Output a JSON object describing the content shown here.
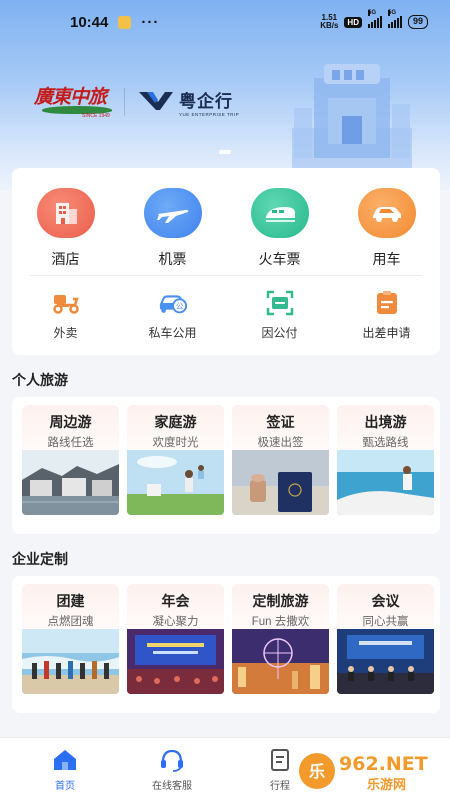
{
  "status_bar": {
    "time": "10:44",
    "dots": "···",
    "net_speed_value": "1.51",
    "net_speed_unit": "KB/s",
    "hd": "HD",
    "signal1": "5G",
    "signal2": "5G",
    "battery": "99"
  },
  "brand": {
    "guangzhong_name": "廣東中旅",
    "guangzhong_since": "SINCE 1949",
    "yueqixing_name": "粤企行",
    "yueqixing_en": "YUE ENTERPRISE TRIP"
  },
  "services": [
    {
      "label": "酒店",
      "icon": "hotel-icon",
      "color": "#ef6e5b"
    },
    {
      "label": "机票",
      "icon": "plane-icon",
      "color": "#4a8ff2"
    },
    {
      "label": "火车票",
      "icon": "train-icon",
      "color": "#37c39a"
    },
    {
      "label": "用车",
      "icon": "car-icon",
      "color": "#f5953c"
    }
  ],
  "quick_actions": [
    {
      "label": "外卖",
      "icon": "scooter-icon"
    },
    {
      "label": "私车公用",
      "icon": "private-car-icon"
    },
    {
      "label": "因公付",
      "icon": "scan-pay-icon"
    },
    {
      "label": "出差申请",
      "icon": "travel-request-icon"
    }
  ],
  "personal_travel": {
    "title": "个人旅游",
    "items": [
      {
        "title": "周边游",
        "subtitle": "路线任选"
      },
      {
        "title": "家庭游",
        "subtitle": "欢度时光"
      },
      {
        "title": "签证",
        "subtitle": "极速出签"
      },
      {
        "title": "出境游",
        "subtitle": "甄选路线"
      }
    ]
  },
  "enterprise_custom": {
    "title": "企业定制",
    "items": [
      {
        "title": "团建",
        "subtitle": "点燃团魂"
      },
      {
        "title": "年会",
        "subtitle": "凝心聚力"
      },
      {
        "title": "定制旅游",
        "subtitle": "Fun 去撒欢"
      },
      {
        "title": "会议",
        "subtitle": "同心共赢"
      }
    ]
  },
  "tabbar": {
    "home": "首页",
    "service": "在线客服",
    "trip": "行程"
  },
  "watermark": {
    "brand": "962.NET",
    "sub": "乐游网"
  },
  "colors": {
    "accent": "#2d6ff2",
    "hotel": "#ef6e5b",
    "plane": "#4a8ff2",
    "train": "#37c39a",
    "car": "#f5953c",
    "quick_icon": "#f08a3c"
  }
}
